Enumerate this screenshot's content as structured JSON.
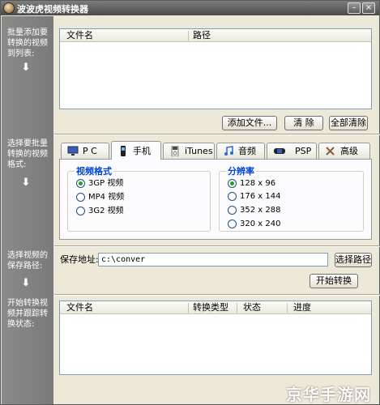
{
  "window": {
    "title": "波波虎视频转换器",
    "minimize_glyph": "–",
    "close_glyph": "×"
  },
  "steps": [
    {
      "text": "批量添加要转换的视频到列表:",
      "arrow": "⬇"
    },
    {
      "text": "选择要批量转换的视频格式:",
      "arrow": "⬇"
    },
    {
      "text": "选择视频的保存路径:",
      "arrow": "⬇"
    },
    {
      "text": "开始转换视频并跟踪转换状态:"
    }
  ],
  "file_list": {
    "columns": [
      "文件名",
      "路径"
    ]
  },
  "file_buttons": {
    "add": "添加文件...",
    "clear": "清 除",
    "clear_all": "全部清除"
  },
  "tabs": [
    {
      "label": "P C",
      "icon": "monitor-icon"
    },
    {
      "label": "手机",
      "icon": "mobile-phone-icon",
      "active": true
    },
    {
      "label": "iTunes",
      "icon": "ipod-icon"
    },
    {
      "label": "音频",
      "icon": "music-note-icon"
    },
    {
      "label": "PSP",
      "icon": "psp-icon"
    },
    {
      "label": "高级",
      "icon": "tools-icon"
    }
  ],
  "format_group": {
    "title": "视频格式",
    "options": [
      {
        "label": "3GP 视频",
        "checked": true
      },
      {
        "label": "MP4 视频",
        "checked": false
      },
      {
        "label": "3G2 视频",
        "checked": false
      }
    ]
  },
  "resolution_group": {
    "title": "分辨率",
    "options": [
      {
        "label": "128 x 96",
        "checked": true
      },
      {
        "label": "176 x 144",
        "checked": false
      },
      {
        "label": "352 x 288",
        "checked": false
      },
      {
        "label": "320 x 240",
        "checked": false
      }
    ]
  },
  "save": {
    "label": "保存地址:",
    "path": "c:\\conver",
    "browse": "选择路径",
    "start": "开始转换"
  },
  "convert_list": {
    "columns": [
      "文件名",
      "转换类型",
      "状态",
      "进度"
    ]
  },
  "watermark": "京华手游网",
  "colors": {
    "group_title": "#0046d5",
    "radio_dot": "#21a121",
    "side_panel": "#7a7a7a"
  }
}
